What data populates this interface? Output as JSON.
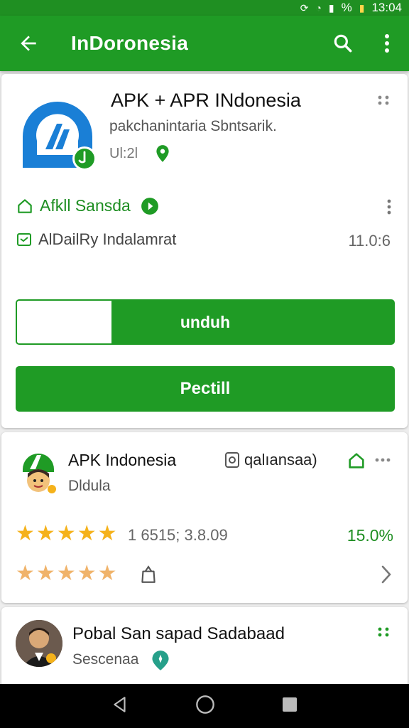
{
  "status_bar": {
    "time": "13:04",
    "battery_label": "%"
  },
  "app_bar": {
    "title": "InDoronesia"
  },
  "app_card": {
    "name": "APK + APR INdonesia",
    "publisher": "pakchanintaria Sbntsarik.",
    "meta_text": "Ul:2l",
    "developer": "Afkll Sansda",
    "updated_label": "AlDailRy Indalamrat",
    "updated_value": "11.0:6",
    "download_label": "unduh",
    "download_progress": 0.25,
    "install_label": "Pectill"
  },
  "review_card": {
    "title": "APK Indonesia",
    "subtitle": "Dldula",
    "badge_text": "qalıansaa)",
    "rating_count": "1 6515; 3.8.09",
    "percent": "15.0%",
    "rating": 5
  },
  "user_card": {
    "name": "Pobal San sapad Sadabaad",
    "subtitle": "Sescenaa"
  },
  "colors": {
    "primary": "#1f9b25",
    "star_gold": "#f5b21b",
    "star_pale": "#f0b36a"
  },
  "icons": [
    "back-arrow-icon",
    "search-icon",
    "more-vert-icon",
    "home-outline-icon",
    "calendar-icon",
    "verified-icon",
    "star-icon",
    "chevron-right-icon",
    "shopping-bag-icon",
    "location-pin-icon"
  ]
}
